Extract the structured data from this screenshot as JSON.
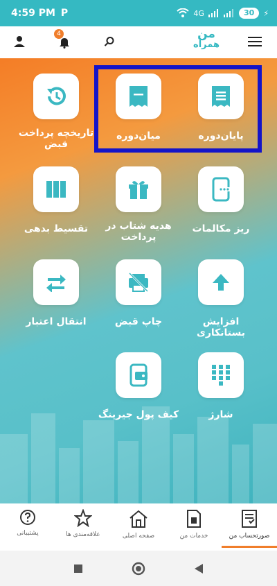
{
  "status": {
    "time": "4:59 PM",
    "carrier_icon": "P",
    "network": "4G",
    "battery": "30"
  },
  "appbar": {
    "logo_line1": "من",
    "logo_line2": "همراه",
    "notification_count": "4"
  },
  "tiles": [
    {
      "id": "payan-doreh",
      "label": "پایان‌دوره",
      "icon": "receipt-icon"
    },
    {
      "id": "mian-doreh",
      "label": "میان‌دوره",
      "icon": "receipt-half-icon"
    },
    {
      "id": "tarikhche",
      "label": "تاریخچه پرداخت قبض",
      "icon": "history-icon"
    },
    {
      "id": "riz",
      "label": "ریز مکالمات",
      "icon": "call-details-icon"
    },
    {
      "id": "hadie",
      "label": "هدیه شتاب در پرداخت",
      "icon": "gift-icon"
    },
    {
      "id": "taghsit",
      "label": "تقسیط بدهی",
      "icon": "installments-icon"
    },
    {
      "id": "afzayesh",
      "label": "افزایش بستانکاری",
      "icon": "arrow-up-icon"
    },
    {
      "id": "chap",
      "label": "چاپ قبض",
      "icon": "print-bill-icon"
    },
    {
      "id": "enteghal",
      "label": "انتقال اعتبار",
      "icon": "transfer-icon"
    },
    {
      "id": "sharj",
      "label": "شارژ",
      "icon": "keypad-icon"
    },
    {
      "id": "kif",
      "label": "کیف پول جیرینگ",
      "icon": "wallet-icon"
    }
  ],
  "bottom_nav": [
    {
      "label": "صورتحساب من",
      "icon": "bill-icon",
      "active": true
    },
    {
      "label": "خدمات من",
      "icon": "sim-card-icon",
      "active": false
    },
    {
      "label": "صفحه اصلی",
      "icon": "home-icon",
      "active": false
    },
    {
      "label": "علاقه‌مندی ها",
      "icon": "star-icon",
      "active": false
    },
    {
      "label": "پشتیبانی",
      "icon": "help-icon",
      "active": false
    }
  ],
  "colors": {
    "accent": "#35b9c2",
    "orange": "#f07e2b",
    "highlight": "#1414c8"
  }
}
